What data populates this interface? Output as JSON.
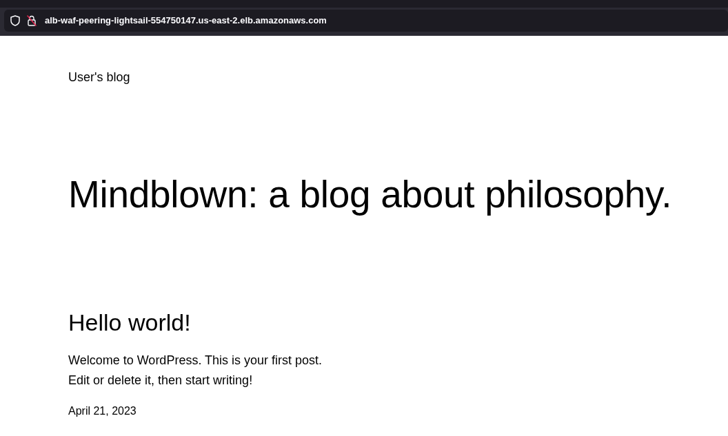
{
  "browser": {
    "url": "alb-waf-peering-lightsail-554750147.us-east-2.elb.amazonaws.com"
  },
  "site_title": "User's blog",
  "heading": "Mindblown: a blog about philosophy.",
  "posts": [
    {
      "title": "Hello world!",
      "excerpt": "Welcome to WordPress. This is your first post. Edit or delete it, then start writing!",
      "date": "April 21, 2023"
    }
  ]
}
